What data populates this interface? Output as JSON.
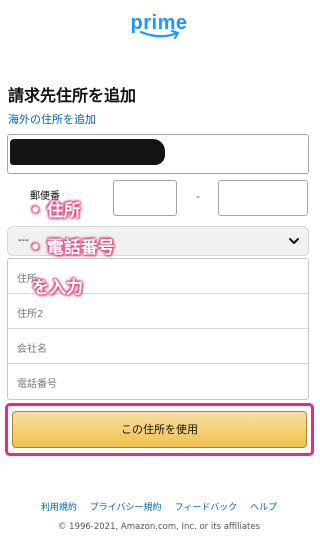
{
  "brand": {
    "logo_text": "prime",
    "accent": "#1a98ff"
  },
  "form": {
    "title": "請求先住所を追加",
    "intl_link": "海外の住所を追加",
    "postal_label": "郵便番",
    "zip_separator": "-",
    "prefecture_select": "---",
    "fields": [
      {
        "placeholder": "住所"
      },
      {
        "placeholder": "住所2"
      },
      {
        "placeholder": "会社名"
      },
      {
        "placeholder": "電話番号"
      }
    ],
    "submit_label": "この住所を使用"
  },
  "annotation": {
    "line1": "住所",
    "line2": "電話番号",
    "line3": "を入力",
    "color": "#e8437f",
    "highlight_color": "#f0277f"
  },
  "footer": {
    "links": [
      "利用規約",
      "プライバシー規約",
      "フィードバック",
      "ヘルプ"
    ],
    "copyright": "© 1996-2021, Amazon.com, Inc. or its affiliates"
  }
}
